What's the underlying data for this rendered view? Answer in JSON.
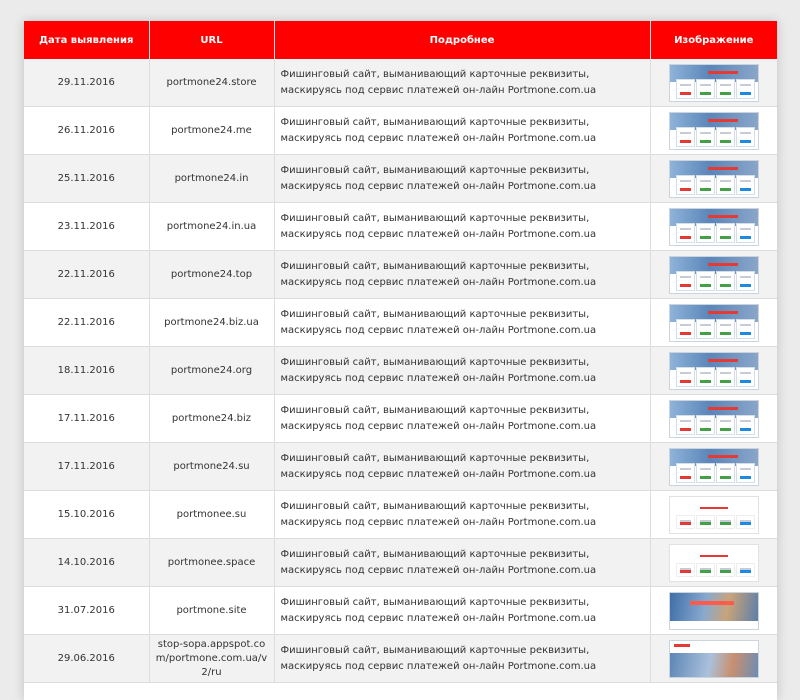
{
  "table": {
    "headers": {
      "date": "Дата выявления",
      "url": "URL",
      "details": "Подробнее",
      "image": "Изображение"
    },
    "rows": [
      {
        "date": "29.11.2016",
        "url": "portmone24.store",
        "details": "Фишинговый сайт, выманивающий карточные реквизиты, маскируясь под сервис платежей он-лайн Portmone.com.ua",
        "thumb": "blue"
      },
      {
        "date": "26.11.2016",
        "url": "portmone24.me",
        "details": "Фишинговый сайт, выманивающий карточные реквизиты, маскируясь под сервис платежей он-лайн Portmone.com.ua",
        "thumb": "blue"
      },
      {
        "date": "25.11.2016",
        "url": "portmone24.in",
        "details": "Фишинговый сайт, выманивающий карточные реквизиты, маскируясь под сервис платежей он-лайн Portmone.com.ua",
        "thumb": "blue"
      },
      {
        "date": "23.11.2016",
        "url": "portmone24.in.ua",
        "details": "Фишинговый сайт, выманивающий карточные реквизиты, маскируясь под сервис платежей он-лайн Portmone.com.ua",
        "thumb": "blue"
      },
      {
        "date": "22.11.2016",
        "url": "portmone24.top",
        "details": "Фишинговый сайт, выманивающий карточные реквизиты, маскируясь под сервис платежей он-лайн Portmone.com.ua",
        "thumb": "blue"
      },
      {
        "date": "22.11.2016",
        "url": "portmone24.biz.ua",
        "details": "Фишинговый сайт, выманивающий карточные реквизиты, маскируясь под сервис платежей он-лайн Portmone.com.ua",
        "thumb": "blue"
      },
      {
        "date": "18.11.2016",
        "url": "portmone24.org",
        "details": "Фишинговый сайт, выманивающий карточные реквизиты, маскируясь под сервис платежей он-лайн Portmone.com.ua",
        "thumb": "blue"
      },
      {
        "date": "17.11.2016",
        "url": "portmone24.biz",
        "details": "Фишинговый сайт, выманивающий карточные реквизиты, маскируясь под сервис платежей он-лайн Portmone.com.ua",
        "thumb": "blue"
      },
      {
        "date": "17.11.2016",
        "url": "portmone24.su",
        "details": "Фишинговый сайт, выманивающий карточные реквизиты, маскируясь под сервис платежей он-лайн Portmone.com.ua",
        "thumb": "blue"
      },
      {
        "date": "15.10.2016",
        "url": "portmonee.su",
        "details": "Фишинговый сайт, выманивающий карточные реквизиты, маскируясь под сервис платежей он-лайн Portmone.com.ua",
        "thumb": "light"
      },
      {
        "date": "14.10.2016",
        "url": "portmonee.space",
        "details": "Фишинговый сайт, выманивающий карточные реквизиты, маскируясь под сервис платежей он-лайн Portmone.com.ua",
        "thumb": "light"
      },
      {
        "date": "31.07.2016",
        "url": "portmone.site",
        "details": "Фишинговый сайт, выманивающий карточные реквизиты, маскируясь под сервис платежей он-лайн Portmone.com.ua",
        "thumb": "photo"
      },
      {
        "date": "29.06.2016",
        "url": "stop-sopa.appspot.com/portmone.com.ua/v2/ru",
        "details": "Фишинговый сайт, выманивающий карточные реквизиты, маскируясь под сервис платежей он-лайн Portmone.com.ua",
        "thumb": "photo2"
      }
    ]
  },
  "colors": {
    "header_bg": "#ff0000",
    "header_text": "#ffffff",
    "row_alt_bg": "#f2f2f2"
  }
}
